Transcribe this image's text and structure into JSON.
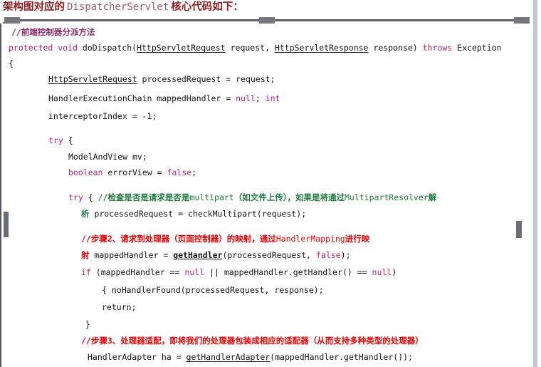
{
  "title": {
    "prefix": "架构图对应的",
    "mono": "DispatcherServlet",
    "suffix": "核心代码如下："
  },
  "colors": {
    "title": "#8c1b1b",
    "title_mono": "#a05a72",
    "keyword": "#b4207a",
    "comment_purple": "#8c2d6b",
    "comment_red": "#ee0000",
    "comment_green": "#1f7a3d",
    "code_text": "#141414",
    "rail": "#5b5b6b",
    "bracket": "#76767f",
    "right_strip": "#c3c7d1",
    "background": "#ffffff"
  },
  "code": {
    "language": "java",
    "lines": [
      {
        "id": "l1",
        "text": "//前端控制器分派方法"
      },
      {
        "id": "l2a",
        "text": "protected"
      },
      {
        "id": "l2b",
        "text": "void"
      },
      {
        "id": "l2c",
        "text": "doDispatch("
      },
      {
        "id": "l2d",
        "text": "HttpServletRequest"
      },
      {
        "id": "l2e",
        "text": " request, "
      },
      {
        "id": "l2f",
        "text": "HttpServletResponse"
      },
      {
        "id": "l2g",
        "text": " response)"
      },
      {
        "id": "l2h",
        "text": "throws"
      },
      {
        "id": "l2i",
        "text": "Exception"
      },
      {
        "id": "l3",
        "text": "{"
      },
      {
        "id": "l4a",
        "text": "HttpServletRequest"
      },
      {
        "id": "l4b",
        "text": " processedRequest = request;"
      },
      {
        "id": "l5a",
        "text": "HandlerExecutionChain mappedHandler = "
      },
      {
        "id": "l5b",
        "text": "null"
      },
      {
        "id": "l5c",
        "text": "; "
      },
      {
        "id": "l5d",
        "text": "int"
      },
      {
        "id": "l6",
        "text": "interceptorIndex = -1;"
      },
      {
        "id": "l7a",
        "text": "try"
      },
      {
        "id": "l7b",
        "text": " {"
      },
      {
        "id": "l8",
        "text": "ModelAndView mv;"
      },
      {
        "id": "l9a",
        "text": "boolean"
      },
      {
        "id": "l9b",
        "text": " errorView = "
      },
      {
        "id": "l9c",
        "text": "false"
      },
      {
        "id": "l9d",
        "text": ";"
      },
      {
        "id": "l10a",
        "text": "try"
      },
      {
        "id": "l10b",
        "text": " { "
      },
      {
        "id": "l10c",
        "text": "//检查是否是请求是否是"
      },
      {
        "id": "l10d",
        "text": "multipart"
      },
      {
        "id": "l10e",
        "text": "（如文件上传），如果是将通过"
      },
      {
        "id": "l10f",
        "text": "MultipartResolver"
      },
      {
        "id": "l10g",
        "text": "解"
      },
      {
        "id": "l11a",
        "text": "析"
      },
      {
        "id": "l11b",
        "text": " processedRequest = checkMultipart(request);"
      },
      {
        "id": "l12a",
        "text": "//步骤2、请求到处理器（页面控制器）的映射，通过"
      },
      {
        "id": "l12b",
        "text": "HandlerMapping"
      },
      {
        "id": "l12c",
        "text": "进行映"
      },
      {
        "id": "l13a",
        "text": "射"
      },
      {
        "id": "l13b",
        "text": " mappedHandler = "
      },
      {
        "id": "l13c",
        "text": "getHandler"
      },
      {
        "id": "l13d",
        "text": "(processedRequest, "
      },
      {
        "id": "l13e",
        "text": "false"
      },
      {
        "id": "l13f",
        "text": ");"
      },
      {
        "id": "l14a",
        "text": "if"
      },
      {
        "id": "l14b",
        "text": " (mappedHandler == "
      },
      {
        "id": "l14c",
        "text": "null"
      },
      {
        "id": "l14d",
        "text": " || mappedHandler.getHandler() == "
      },
      {
        "id": "l14e",
        "text": "null"
      },
      {
        "id": "l14f",
        "text": ")"
      },
      {
        "id": "l15",
        "text": "{ noHandlerFound(processedRequest, response);"
      },
      {
        "id": "l16",
        "text": "return;"
      },
      {
        "id": "l17",
        "text": "}"
      },
      {
        "id": "l18",
        "text": "//步骤3、处理器适配，即将我们的处理器包装成相应的适配器（从而支持多种类型的处理器）"
      },
      {
        "id": "l19a",
        "text": "HandlerAdapter ha = "
      },
      {
        "id": "l19b",
        "text": "getHandlerAdapter"
      },
      {
        "id": "l19c",
        "text": "(mappedHandler.getHandler());"
      }
    ]
  }
}
